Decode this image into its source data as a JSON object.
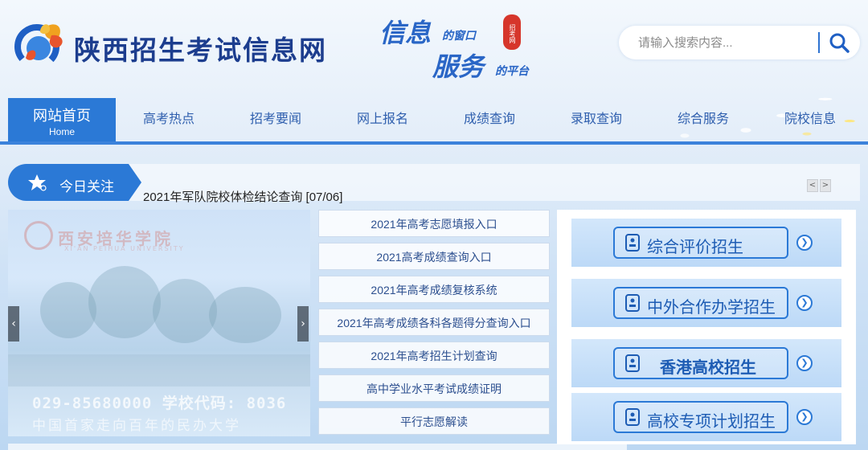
{
  "header": {
    "site_title": "陕西招生考试信息网",
    "slogan": {
      "line1_big": "信息",
      "line1_small": "的窗口",
      "line2_big": "服务",
      "line2_small": "的平台",
      "seal": "招考网"
    },
    "search": {
      "placeholder": "请输入搜索内容..."
    }
  },
  "nav": {
    "items": [
      {
        "label": "网站首页",
        "sublabel": "Home",
        "active": true
      },
      {
        "label": "高考热点"
      },
      {
        "label": "招考要闻"
      },
      {
        "label": "网上报名"
      },
      {
        "label": "成绩查询"
      },
      {
        "label": "录取查询"
      },
      {
        "label": "综合服务"
      },
      {
        "label": "院校信息"
      }
    ]
  },
  "focus": {
    "label": "今日关注",
    "headline": "2021年军队院校体检结论查询  [07/06]",
    "prev_arrow": "<",
    "next_arrow": ">"
  },
  "slider": {
    "school_name": "西安培华学院",
    "school_name_en": "XI'AN PEIHUA UNIVERSITY",
    "phone_line": "029-85680000  学校代码: 8036",
    "motto": "中国首家走向百年的民办大学",
    "prev": "‹",
    "next": "›"
  },
  "quick_links": [
    "2021年高考志愿填报入口",
    "2021高考成绩查询入口",
    "2021年高考成绩复核系统",
    "2021年高考成绩各科各题得分查询入口",
    "2021年高考招生计划查询",
    "高中学业水平考试成绩证明",
    "平行志愿解读"
  ],
  "promos": [
    {
      "label": "综合评价招生"
    },
    {
      "label": "中外合作办学招生"
    },
    {
      "label": "香港高校招生"
    },
    {
      "label": "高校专项计划招生"
    }
  ],
  "colors": {
    "brand_blue": "#2b79d6",
    "title_blue": "#1c3d8e"
  }
}
